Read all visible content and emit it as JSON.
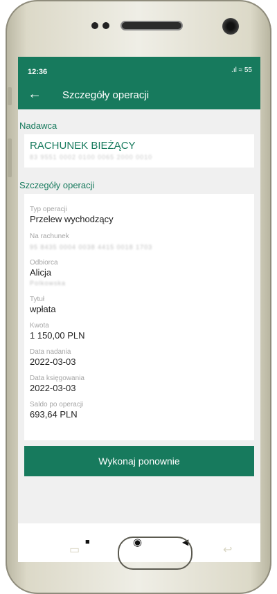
{
  "status": {
    "time": "12:36",
    "icons": ".ıl ≈ 55"
  },
  "appbar": {
    "back_icon": "←",
    "title": "Szczegóły operacji"
  },
  "sender": {
    "section_label": "Nadawca",
    "account_name": "RACHUNEK BIEŻĄCY",
    "account_number": "83 9551 0002 0100 0065 2000 0010"
  },
  "details": {
    "section_label": "Szczegóły operacji",
    "type_label": "Typ operacji",
    "type_value": "Przelew wychodzący",
    "to_account_label": "Na rachunek",
    "to_account_value": "95 8435 0004 0038 4415 0018 1703",
    "recipient_label": "Odbiorca",
    "recipient_first": "Alicja",
    "recipient_last": "Polkowska",
    "title_label": "Tytuł",
    "title_value": "wpłata",
    "amount_label": "Kwota",
    "amount_value": "1 150,00 PLN",
    "sent_label": "Data nadania",
    "sent_value": "2022-03-03",
    "booked_label": "Data księgowania",
    "booked_value": "2022-03-03",
    "balance_label": "Saldo po operacji",
    "balance_value": "693,64 PLN"
  },
  "actions": {
    "repeat_label": "Wykonaj ponownie"
  },
  "navbar": {
    "recents_icon": "■",
    "home_icon": "◉",
    "back_icon": "◀"
  },
  "colors": {
    "brand": "#177a5d"
  }
}
